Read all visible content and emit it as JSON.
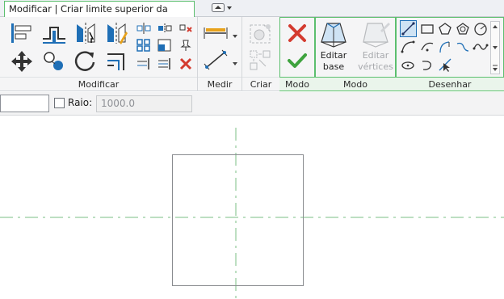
{
  "context_tab": {
    "label": "Modificar | Criar limite superior da mescla"
  },
  "panels": {
    "modificar": "Modificar",
    "medir": "Medir",
    "criar": "Criar",
    "modo1": "Modo",
    "modo2": "Modo",
    "desenhar": "Desenhar"
  },
  "buttons": {
    "editar_base": "Editar\nbase",
    "editar_base_line1": "Editar",
    "editar_base_line2": "base",
    "editar_vertices_line1": "Editar",
    "editar_vertices_line2": "vértices"
  },
  "options": {
    "raio_label": "Raio:",
    "raio_value": "1000.0",
    "raio_checked": false
  },
  "colors": {
    "accent_green": "#5cbf6e",
    "finish_check": "#3ea33e",
    "cancel_x": "#d43b2f",
    "icon_blue": "#1f6fb6",
    "reference_plane": "#7bbf85"
  }
}
